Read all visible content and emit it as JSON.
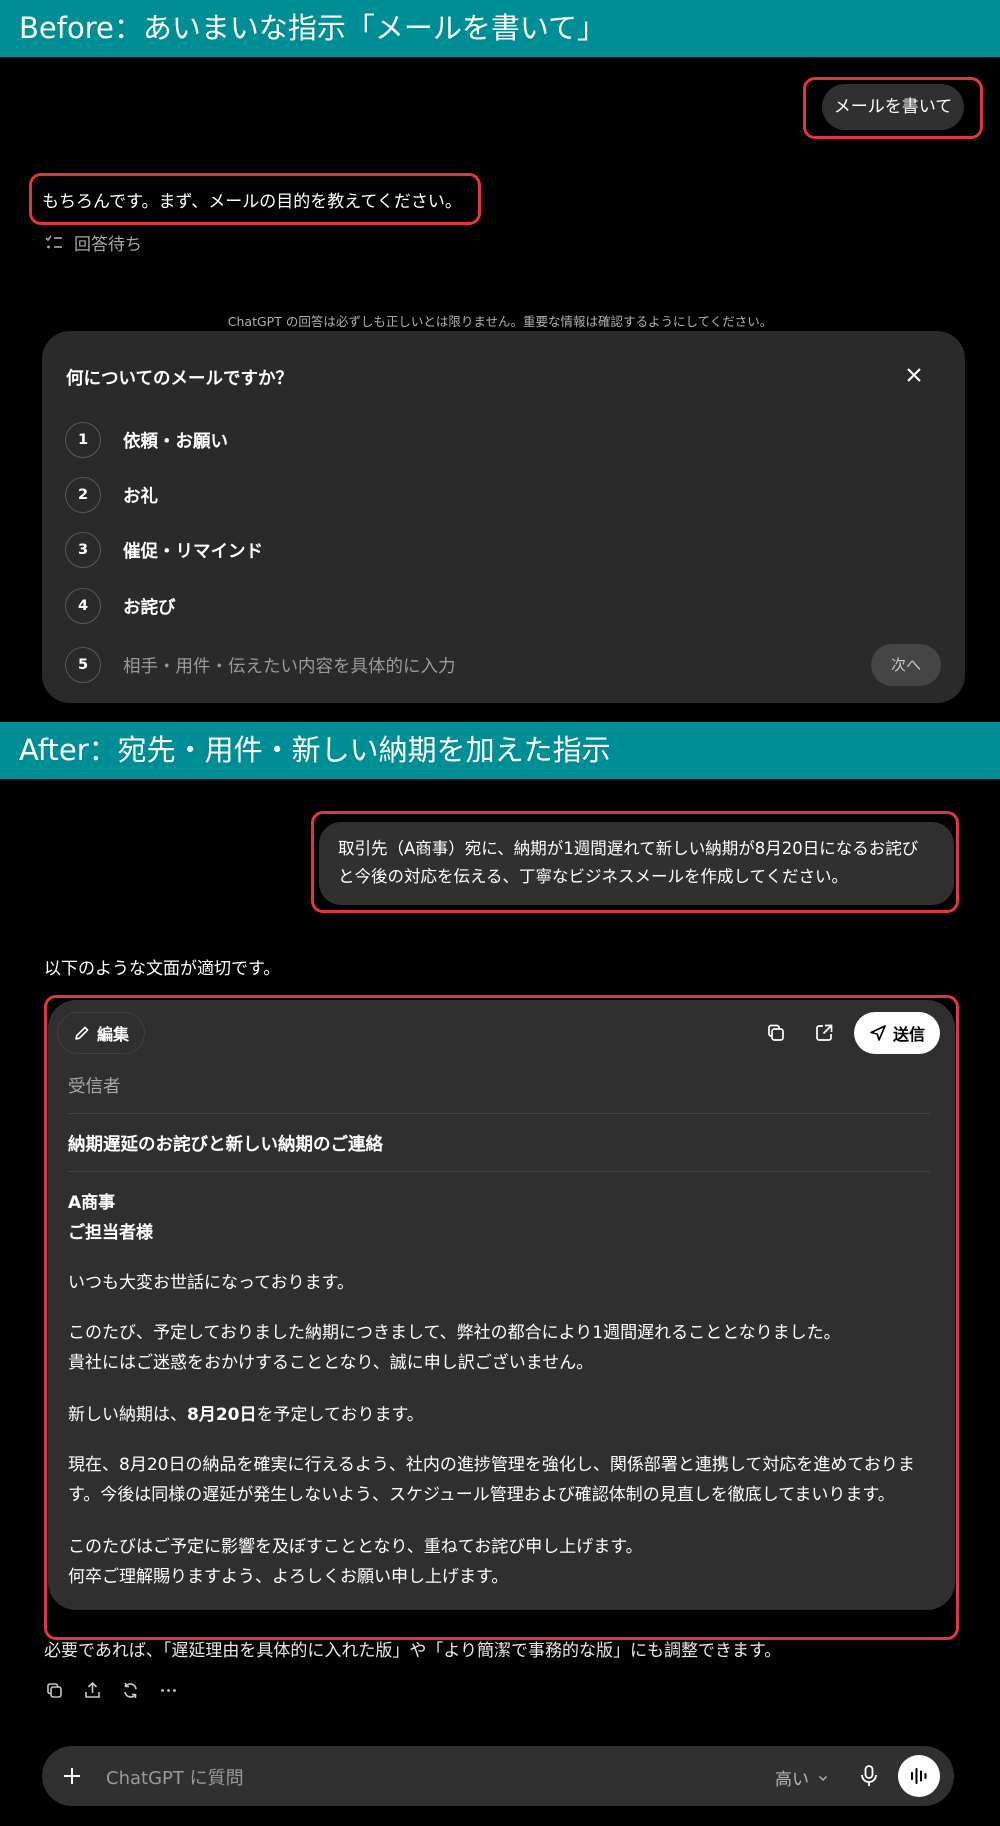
{
  "before_banner": "Before：あいまいな指示「メールを書いて」",
  "after_banner": "After：宛先・用件・新しい納期を加えた指示",
  "chat1": {
    "user_message": "メールを書いて",
    "assistant_message": "もちろんです。まず、メールの目的を教えてください。",
    "pending_label": "回答待ち",
    "disclaimer": "ChatGPT の回答は必ずしも正しいとは限りません。重要な情報は確認するようにしてください。"
  },
  "question_panel": {
    "title": "何についてのメールですか？",
    "options": [
      {
        "num": "1",
        "label": "依頼・お願い"
      },
      {
        "num": "2",
        "label": "お礼"
      },
      {
        "num": "3",
        "label": "催促・リマインド"
      },
      {
        "num": "4",
        "label": "お詫び"
      }
    ],
    "custom_num": "5",
    "custom_placeholder": "相手・用件・伝えたい内容を具体的に入力",
    "next_label": "次へ"
  },
  "chat2": {
    "user_line1": "取引先（A商事）宛に、納期が1週間遅れて新しい納期が8月20日になるお詫び",
    "user_line2": "と今後の対応を伝える、丁寧なビジネスメールを作成してください。",
    "intro": "以下のような文面が適切です。",
    "footnote": "必要であれば、「遅延理由を具体的に入れた版」や「より簡潔で事務的な版」にも調整できます。"
  },
  "email_card": {
    "edit_label": "編集",
    "send_label": "送信",
    "recipient_placeholder": "受信者",
    "subject": "納期遅延のお詫びと新しい納期のご連絡",
    "addressee_company": "A商事",
    "addressee_person": "ご担当者様",
    "greeting": "いつも大変お世話になっております。",
    "para1_line1": "このたび、予定しておりました納期につきまして、弊社の都合により1週間遅れることとなりました。",
    "para1_line2": "貴社にはご迷惑をおかけすることとなり、誠に申し訳ございません。",
    "para2_prefix": "新しい納期は、",
    "para2_bold": "8月20日",
    "para2_suffix": "を予定しております。",
    "para3_line1": "現在、8月20日の納品を確実に行えるよう、社内の進捗管理を強化し、関係部署と連携して対応を進めておりま",
    "para3_line2": "す。今後は同様の遅延が発生しないよう、スケジュール管理および確認体制の見直しを徹底してまいります。",
    "para4_line1": "このたびはご予定に影響を及ぼすこととなり、重ねてお詫び申し上げます。",
    "para4_line2": "何卒ご理解賜りますよう、よろしくお願い申し上げます。"
  },
  "composer": {
    "placeholder": "ChatGPT に質問",
    "model_label": "高い"
  },
  "colors": {
    "banner": "#008e96",
    "highlight": "#e0363c",
    "panel_bg": "#2a2a2a",
    "bubble_bg": "#303030"
  }
}
